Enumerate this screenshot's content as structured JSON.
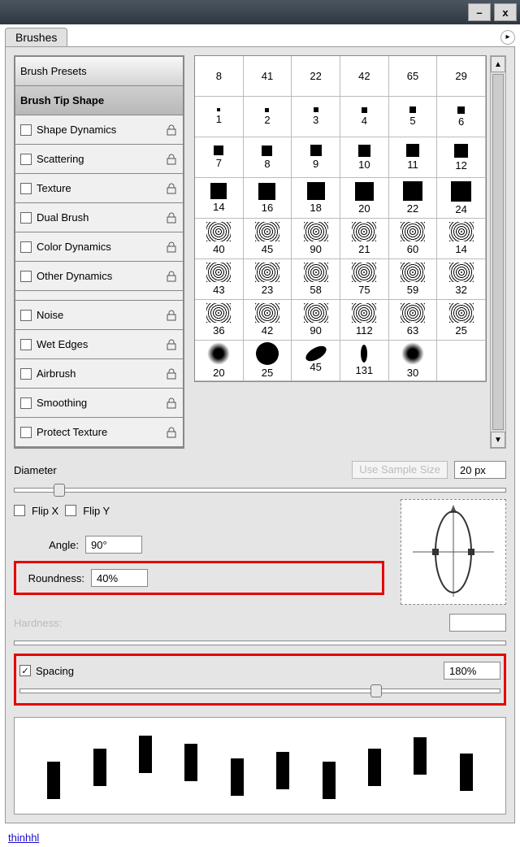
{
  "titlebar": {
    "minimize": "–",
    "close": "x"
  },
  "tab": {
    "label": "Brushes",
    "menu": "▸"
  },
  "sidebar": {
    "presets": "Brush Presets",
    "tipshape": "Brush Tip Shape",
    "items": [
      {
        "label": "Shape Dynamics"
      },
      {
        "label": "Scattering"
      },
      {
        "label": "Texture"
      },
      {
        "label": "Dual Brush"
      },
      {
        "label": "Color Dynamics"
      },
      {
        "label": "Other Dynamics"
      }
    ],
    "toggles": [
      {
        "label": "Noise"
      },
      {
        "label": "Wet Edges"
      },
      {
        "label": "Airbrush"
      },
      {
        "label": "Smoothing"
      },
      {
        "label": "Protect Texture"
      }
    ]
  },
  "grid": {
    "row_header": [
      8,
      41,
      22,
      42,
      65,
      29
    ],
    "rows": [
      [
        1,
        2,
        3,
        4,
        5,
        6
      ],
      [
        7,
        8,
        9,
        10,
        11,
        12
      ],
      [
        14,
        16,
        18,
        20,
        22,
        24
      ],
      [
        40,
        45,
        90,
        21,
        60,
        14
      ],
      [
        43,
        23,
        58,
        75,
        59,
        32
      ],
      [
        36,
        42,
        90,
        112,
        63,
        25
      ],
      [
        20,
        25,
        45,
        131,
        30,
        ""
      ]
    ]
  },
  "scroll": {
    "up": "▲",
    "down": "▼"
  },
  "controls": {
    "diameter_label": "Diameter",
    "sample_btn": "Use Sample Size",
    "diameter_value": "20 px",
    "flipx": "Flip X",
    "flipy": "Flip Y",
    "angle_label": "Angle:",
    "angle_value": "90°",
    "roundness_label": "Roundness:",
    "roundness_value": "40%",
    "hardness_label": "Hardness:",
    "spacing_label": "Spacing",
    "spacing_value": "180%"
  },
  "footer": {
    "link": "thinhhl"
  }
}
